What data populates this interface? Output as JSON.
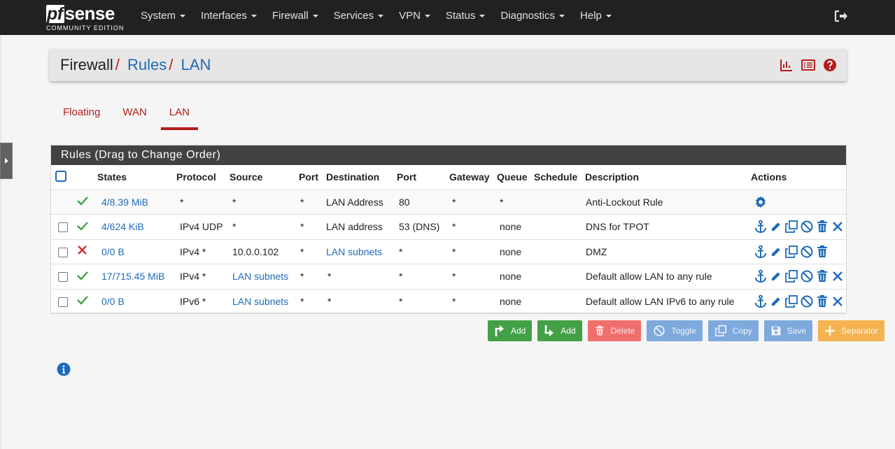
{
  "brand": {
    "logo": "sense",
    "logo_pf": "pf",
    "edition": "COMMUNITY EDITION"
  },
  "nav": [
    "System",
    "Interfaces",
    "Firewall",
    "Services",
    "VPN",
    "Status",
    "Diagnostics",
    "Help"
  ],
  "breadcrumb": {
    "root": "Firewall",
    "sep": "/",
    "rules": "Rules",
    "current": "LAN"
  },
  "tabs": [
    "Floating",
    "WAN",
    "LAN"
  ],
  "active_tab": "LAN",
  "panel": {
    "title": "Rules (Drag to Change Order)",
    "headers": [
      "States",
      "Protocol",
      "Source",
      "Port",
      "Destination",
      "Port",
      "Gateway",
      "Queue",
      "Schedule",
      "Description",
      "Actions"
    ]
  },
  "rows": [
    {
      "status": "pass",
      "states": "4/8.39 MiB",
      "protocol": "*",
      "source": "*",
      "sport": "*",
      "dest": "LAN Address",
      "dport": "80",
      "gateway": "*",
      "queue": "*",
      "schedule": "",
      "description": "Anti-Lockout Rule",
      "locked": true
    },
    {
      "status": "pass",
      "states": "4/624 KiB",
      "protocol": "IPv4 UDP",
      "source": "*",
      "sport": "*",
      "dest": "LAN address",
      "dport": "53 (DNS)",
      "gateway": "*",
      "queue": "none",
      "schedule": "",
      "description": "DNS for TPOT"
    },
    {
      "status": "block",
      "states": "0/0 B",
      "protocol": "IPv4 *",
      "source": "10.0.0.102",
      "sport": "*",
      "dest": "LAN subnets",
      "dport": "*",
      "gateway": "*",
      "queue": "none",
      "schedule": "",
      "description": "DMZ"
    },
    {
      "status": "pass",
      "states": "17/715.45 MiB",
      "protocol": "IPv4 *",
      "source": "LAN subnets",
      "sport": "*",
      "dest": "*",
      "dport": "*",
      "gateway": "*",
      "queue": "none",
      "schedule": "",
      "description": "Default allow LAN to any rule"
    },
    {
      "status": "pass",
      "states": "0/0 B",
      "protocol": "IPv6 *",
      "source": "LAN subnets",
      "sport": "*",
      "dest": "*",
      "dport": "*",
      "gateway": "*",
      "queue": "none",
      "schedule": "",
      "description": "Default allow LAN IPv6 to any rule"
    }
  ],
  "buttons": {
    "add_top": "Add",
    "add_bottom": "Add",
    "delete": "Delete",
    "toggle": "Toggle",
    "copy": "Copy",
    "save": "Save",
    "separator": "Separator"
  },
  "colors": {
    "navbar": "#212121",
    "accent_red": "#b71c1c",
    "link_blue": "#1e6bb8",
    "pass_green": "#43a047",
    "block_red": "#d32f2f"
  }
}
